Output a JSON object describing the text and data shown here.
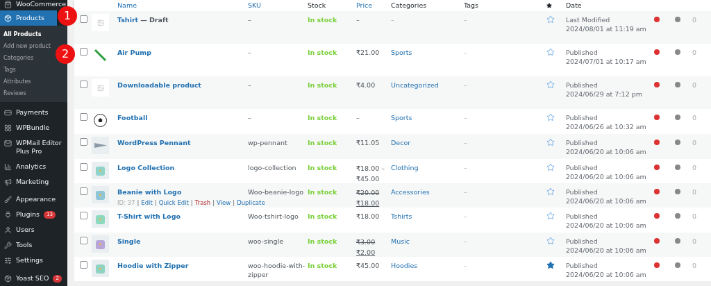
{
  "sidebar": {
    "items": [
      {
        "label": "WooCommerce",
        "selected": false
      },
      {
        "label": "Products",
        "selected": true,
        "children": [
          {
            "label": "All Products",
            "selected": true
          },
          {
            "label": "Add new product",
            "selected": false
          },
          {
            "label": "Categories",
            "selected": false
          },
          {
            "label": "Tags",
            "selected": false
          },
          {
            "label": "Attributes",
            "selected": false
          },
          {
            "label": "Reviews",
            "selected": false
          }
        ]
      },
      {
        "label": "Payments",
        "selected": false
      },
      {
        "label": "WPBundle",
        "selected": false
      },
      {
        "label": "WPMail Editor Plus Pro",
        "selected": false
      },
      {
        "label": "Analytics",
        "selected": false
      },
      {
        "label": "Marketing",
        "selected": false
      },
      {
        "label": "Appearance",
        "selected": false
      },
      {
        "label": "Plugins",
        "selected": false,
        "badge": "13"
      },
      {
        "label": "Users",
        "selected": false
      },
      {
        "label": "Tools",
        "selected": false
      },
      {
        "label": "Settings",
        "selected": false
      },
      {
        "label": "Yoast SEO",
        "selected": false,
        "badge": "2"
      }
    ]
  },
  "annotations": [
    {
      "label": "1"
    },
    {
      "label": "2"
    }
  ],
  "table": {
    "columns": [
      "Name",
      "SKU",
      "Stock",
      "Price",
      "Categories",
      "Tags",
      "Date"
    ],
    "rows": [
      {
        "checked": false,
        "image": {
          "kind": "placeholder"
        },
        "name": "Tshirt",
        "suffix": "— Draft",
        "sku": "–",
        "stock": "In stock",
        "price": {
          "kind": "plain",
          "text": "–"
        },
        "category": "–",
        "tags": "–",
        "featured": false,
        "status": "Last Modified",
        "date": "2024/08/01 at 11:19 am",
        "seo": {
          "color": "#dc3232"
        },
        "readability": {
          "color": "#888888"
        },
        "count": "0"
      },
      {
        "checked": false,
        "name": "Air Pump",
        "sku": "–",
        "stock": "In stock",
        "price": {
          "kind": "plain",
          "text": "₹21.00"
        },
        "category": "Sports",
        "tags": "–",
        "featured": false,
        "status": "Published",
        "date": "2024/07/01 at 10:17 am",
        "seo": {
          "color": "#dc3232"
        },
        "readability": {
          "color": "#888888"
        },
        "count": "0"
      },
      {
        "checked": false,
        "image": {
          "kind": "placeholder"
        },
        "name": "Downloadable product",
        "sku": "–",
        "stock": "In stock",
        "price": {
          "kind": "plain",
          "text": "₹4.00"
        },
        "category": "Uncategorized",
        "tags": "–",
        "featured": false,
        "status": "Published",
        "date": "2024/06/29 at 7:12 pm",
        "seo": {
          "color": "#dc3232"
        },
        "readability": {
          "color": "#888888"
        },
        "count": "0"
      },
      {
        "checked": false,
        "name": "Football",
        "sku": "–",
        "stock": "In stock",
        "price": {
          "kind": "plain",
          "text": "–"
        },
        "category": "Sports",
        "tags": "–",
        "featured": false,
        "status": "Published",
        "date": "2024/06/26 at 10:32 am",
        "seo": {
          "color": "#dc3232"
        },
        "readability": {
          "color": "#888888"
        },
        "count": "0"
      },
      {
        "checked": false,
        "name": "WordPress Pennant",
        "sku": "wp-pennant",
        "stock": "In stock",
        "price": {
          "kind": "plain",
          "text": "₹11.05"
        },
        "category": "Decor",
        "tags": "–",
        "featured": false,
        "status": "Published",
        "date": "2024/06/20 at 10:06 am",
        "seo": {
          "color": "#dc3232"
        },
        "readability": {
          "color": "#888888"
        },
        "count": "0"
      },
      {
        "checked": false,
        "name": "Logo Collection",
        "sku": "logo-collection",
        "stock": "In stock",
        "price": {
          "kind": "range",
          "from": "₹18.00 –",
          "to": "₹45.00"
        },
        "category": "Clothing",
        "tags": "–",
        "featured": false,
        "status": "Published",
        "date": "2024/06/20 at 10:06 am",
        "seo": {
          "color": "#dc3232"
        },
        "readability": {
          "color": "#888888"
        },
        "count": "0"
      },
      {
        "checked": false,
        "name": "Beanie with Logo",
        "actions": {
          "id": "ID: 37",
          "separator": "|",
          "links": [
            {
              "label": "Edit",
              "kind": "link"
            },
            {
              "label": "Quick Edit",
              "kind": "link"
            },
            {
              "label": "Trash",
              "kind": "danger"
            },
            {
              "label": "View",
              "kind": "link"
            },
            {
              "label": "Duplicate",
              "kind": "link"
            }
          ]
        },
        "sku": "Woo-beanie-logo",
        "stock": "In stock",
        "price": {
          "kind": "sale",
          "old": "₹20.00",
          "new": "₹18.00"
        },
        "category": "Accessories",
        "tags": "–",
        "featured": false,
        "status": "Published",
        "date": "2024/06/20 at 10:06 am",
        "seo": {
          "color": "#dc3232"
        },
        "readability": {
          "color": "#888888"
        },
        "count": "0"
      },
      {
        "checked": false,
        "name": "T-Shirt with Logo",
        "sku": "Woo-tshirt-logo",
        "stock": "In stock",
        "price": {
          "kind": "plain",
          "text": "₹18.00"
        },
        "category": "Tshirts",
        "tags": "–",
        "featured": false,
        "status": "Published",
        "date": "2024/06/20 at 10:06 am",
        "seo": {
          "color": "#dc3232"
        },
        "readability": {
          "color": "#888888"
        },
        "count": "0"
      },
      {
        "checked": false,
        "name": "Single",
        "sku": "woo-single",
        "stock": "In stock",
        "price": {
          "kind": "sale",
          "old": "₹3.00",
          "new": "₹2.00"
        },
        "category": "Music",
        "tags": "–",
        "featured": false,
        "status": "Published",
        "date": "2024/06/20 at 10:06 am",
        "seo": {
          "color": "#dc3232"
        },
        "readability": {
          "color": "#888888"
        },
        "count": "0"
      },
      {
        "checked": false,
        "name": "Hoodie with Zipper",
        "sku": "woo-hoodie-with-zipper",
        "stock": "In stock",
        "price": {
          "kind": "plain",
          "text": "₹45.00"
        },
        "category": "Hoodies",
        "tags": "–",
        "featured": true,
        "status": "Published",
        "date": "2024/06/20 at 10:06 am",
        "seo": {
          "color": "#dc3232"
        },
        "readability": {
          "color": "#888888"
        },
        "count": "0"
      }
    ]
  }
}
